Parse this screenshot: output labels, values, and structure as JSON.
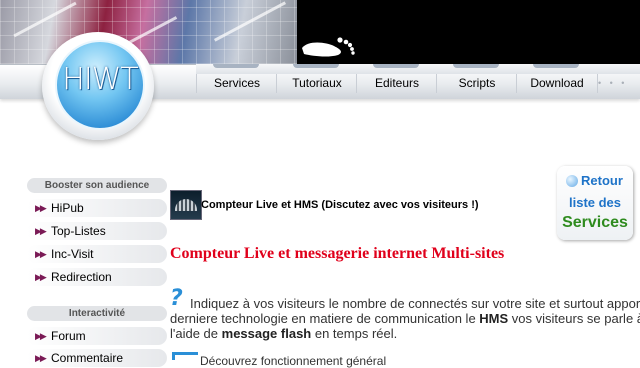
{
  "logo": {
    "text": "HIWT"
  },
  "nav": {
    "items": [
      "Services",
      "Tutoriaux",
      "Editeurs",
      "Scripts",
      "Download"
    ],
    "more": "• • •"
  },
  "sidebar": {
    "sections": [
      {
        "title": "Booster son audience",
        "items": [
          "HiPub",
          "Top-Listes",
          "Inc-Visit",
          "Redirection"
        ]
      },
      {
        "title": "Interactivité",
        "items": [
          "Forum",
          "Commentaire"
        ]
      }
    ]
  },
  "content": {
    "heading": "Compteur Live et HMS (Discutez avec vos visiteurs !)",
    "title": "Compteur Live et messagerie internet Multi-sites",
    "paragraph": {
      "line1": "Indiquez à vos visiteurs le nombre de connectés sur votre site et surtout appor",
      "line2_a": "derniere technologie en matiere de communication le ",
      "line2_b": "HMS",
      "line2_c": " vos visiteurs se parle à",
      "line3_a": "l'aide de ",
      "line3_b": "message flash",
      "line3_c": " en temps réel."
    },
    "next_line": "Découvrez fonctionnement général"
  },
  "retour": {
    "line1": "Retour",
    "line2": "liste des",
    "line3": "Services"
  },
  "colors": {
    "title_red": "#e0001b",
    "link_blue": "#1e73c8",
    "green": "#2e8b1e",
    "nav_bg": "#e9ecef"
  }
}
